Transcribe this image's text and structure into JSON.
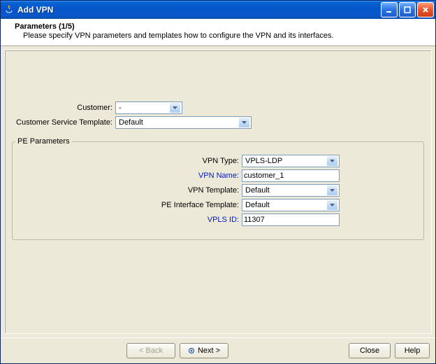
{
  "window": {
    "title": "Add VPN"
  },
  "header": {
    "title": "Parameters (1/5)",
    "subtitle": "Please specify VPN parameters and templates how to configure the VPN and its interfaces."
  },
  "form": {
    "customer_label": "Customer:",
    "customer_value": "-",
    "cst_label": "Customer Service Template:",
    "cst_value": "Default"
  },
  "pe": {
    "legend": "PE Parameters",
    "vpn_type_label": "VPN Type:",
    "vpn_type_value": "VPLS-LDP",
    "vpn_name_label": "VPN Name:",
    "vpn_name_value": "customer_1",
    "vpn_template_label": "VPN Template:",
    "vpn_template_value": "Default",
    "pe_if_template_label": "PE Interface Template:",
    "pe_if_template_value": "Default",
    "vpls_id_label": "VPLS ID:",
    "vpls_id_value": "11307"
  },
  "buttons": {
    "back": "< Back",
    "next": "Next >",
    "close": "Close",
    "help": "Help"
  }
}
